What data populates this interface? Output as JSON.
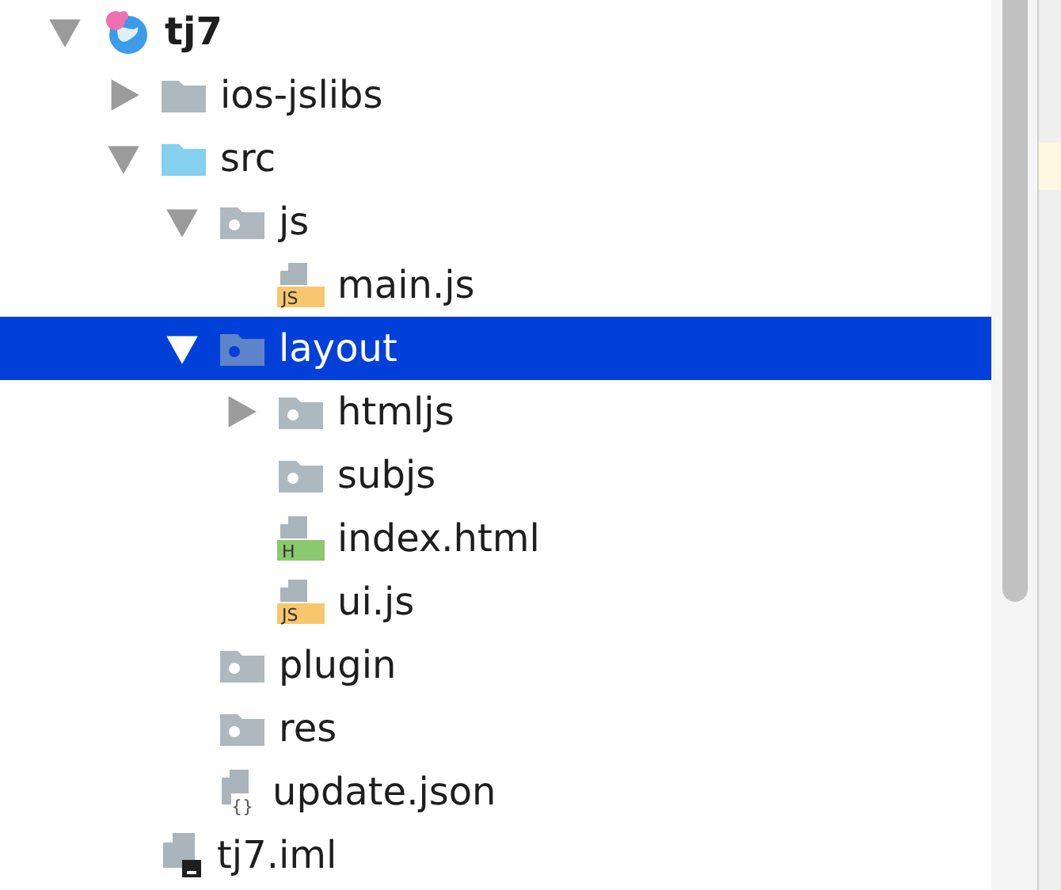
{
  "tree": [
    {
      "label": "tj7",
      "kind": "module",
      "expanded": true,
      "selected": false,
      "children": [
        {
          "label": "ios-jslibs",
          "kind": "folder",
          "expanded": false,
          "selected": false
        },
        {
          "label": "src",
          "kind": "source-folder",
          "expanded": true,
          "selected": false,
          "children": [
            {
              "label": "js",
              "kind": "package",
              "expanded": true,
              "selected": false,
              "children": [
                {
                  "label": "main.js",
                  "kind": "js",
                  "badge": "JS",
                  "selected": false
                }
              ]
            },
            {
              "label": "layout",
              "kind": "package",
              "expanded": true,
              "selected": true,
              "children": [
                {
                  "label": "htmljs",
                  "kind": "package",
                  "expanded": false,
                  "selected": false
                },
                {
                  "label": "subjs",
                  "kind": "package",
                  "selected": false
                },
                {
                  "label": "index.html",
                  "kind": "html",
                  "badge": "H",
                  "selected": false
                },
                {
                  "label": "ui.js",
                  "kind": "js",
                  "badge": "JS",
                  "selected": false
                }
              ]
            },
            {
              "label": "plugin",
              "kind": "package",
              "selected": false
            },
            {
              "label": "res",
              "kind": "package",
              "selected": false
            },
            {
              "label": "update.json",
              "kind": "json",
              "badge": "{}",
              "selected": false
            }
          ]
        },
        {
          "label": "tj7.iml",
          "kind": "iml",
          "selected": false
        }
      ]
    }
  ]
}
